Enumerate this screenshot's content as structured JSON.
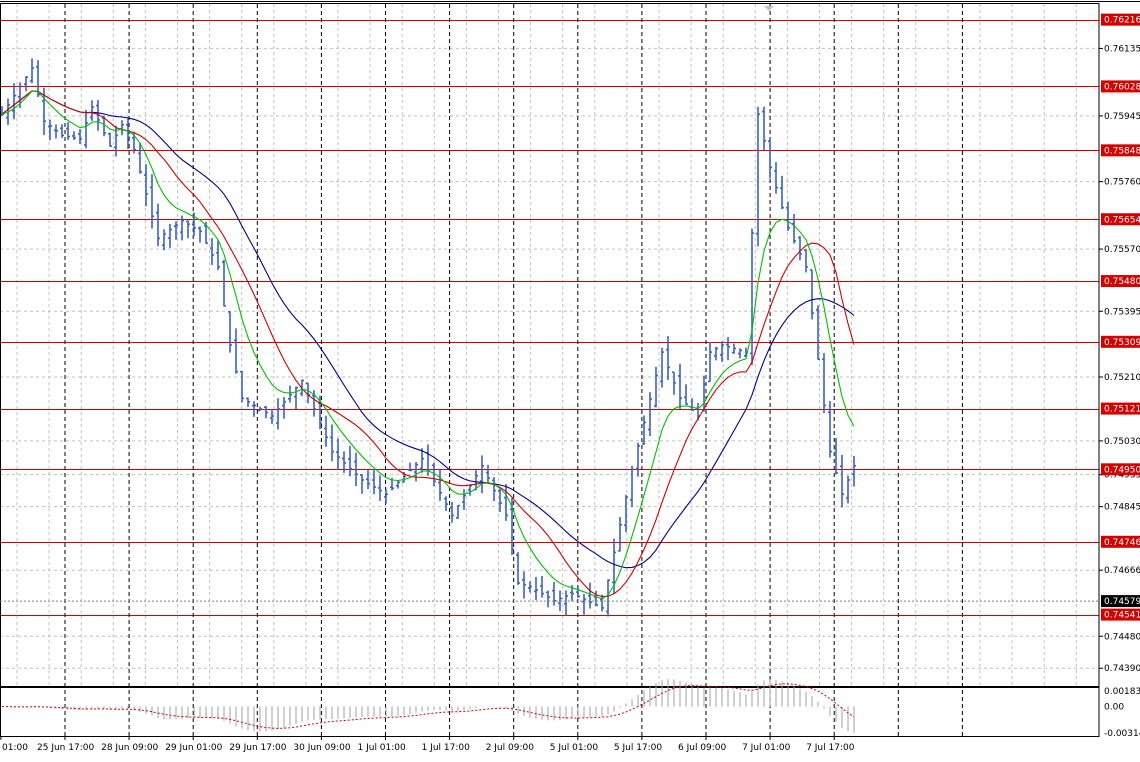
{
  "chart_data": [
    {
      "type": "candlestick",
      "title": "",
      "ylim": [
        0.7434,
        0.7626
      ],
      "grid": true,
      "colors": {
        "background": "#ffffff",
        "bars": "#3a5fcd",
        "grid": "#c0c0c0",
        "vertical_dashed": "#000000",
        "level_lines": "#d40000",
        "level_label_bg": "#d40000",
        "ma_fast": "#00c000",
        "ma_mid": "#d00000",
        "ma_slow": "#000090",
        "current_price_bg": "#000000"
      },
      "price_ticks": [
        "0.76135",
        "0.75945",
        "0.75760",
        "0.75570",
        "0.75395",
        "0.75210",
        "0.75030",
        "0.74935",
        "0.74845",
        "0.74666",
        "0.74480",
        "0.74390"
      ],
      "price_tick_values": [
        0.76135,
        0.75945,
        0.7576,
        0.7557,
        0.75395,
        0.7521,
        0.7503,
        0.74935,
        0.74845,
        0.74666,
        0.7448,
        0.7439
      ],
      "levels": [
        {
          "label": "0.76216",
          "value": 0.76216
        },
        {
          "label": "0.76028",
          "value": 0.76028
        },
        {
          "label": "0.75848",
          "value": 0.75848
        },
        {
          "label": "0.75654",
          "value": 0.75654
        },
        {
          "label": "0.75480",
          "value": 0.7548
        },
        {
          "label": "0.75309",
          "value": 0.75309
        },
        {
          "label": "0.75121",
          "value": 0.75121
        },
        {
          "label": "0.74950",
          "value": 0.7495
        },
        {
          "label": "0.74746",
          "value": 0.74746
        },
        {
          "label": "0.74541",
          "value": 0.74541
        }
      ],
      "current_price": {
        "label": "0.74579",
        "value": 0.74579
      },
      "time_labels": [
        "01:00",
        "25 Jun 17:00",
        "28 Jun 09:00",
        "29 Jun 01:00",
        "29 Jun 17:00",
        "30 Jun 09:00",
        "1 Jul 01:00",
        "1 Jul 17:00",
        "2 Jul 09:00",
        "5 Jul 01:00",
        "5 Jul 17:00",
        "6 Jul 09:00",
        "7 Jul 01:00",
        "7 Jul 17:00"
      ],
      "time_label_positions": [
        0,
        0.5,
        1,
        1.5,
        2,
        2.5,
        3,
        3.5,
        4,
        4.5,
        5,
        5.5,
        6,
        6.5
      ],
      "bar_count": 145,
      "anchors_index": [
        0,
        5,
        7,
        10,
        13,
        15,
        18,
        20,
        22,
        26,
        30,
        33,
        36,
        38,
        40,
        45,
        50,
        55,
        60,
        64,
        70,
        75,
        80,
        84,
        86,
        88,
        92,
        95,
        100,
        105,
        110,
        113,
        116,
        118,
        120,
        124,
        126,
        128,
        131,
        134,
        138,
        140,
        143,
        144
      ],
      "anchors_close": [
        0.7595,
        0.7608,
        0.7593,
        0.7589,
        0.7588,
        0.7597,
        0.7586,
        0.7592,
        0.7585,
        0.756,
        0.7565,
        0.7562,
        0.7552,
        0.753,
        0.7515,
        0.751,
        0.752,
        0.75,
        0.7492,
        0.7488,
        0.7498,
        0.7482,
        0.7496,
        0.7482,
        0.7463,
        0.7462,
        0.7458,
        0.746,
        0.7456,
        0.7495,
        0.7528,
        0.7515,
        0.751,
        0.7528,
        0.753,
        0.7528,
        0.7595,
        0.758,
        0.7563,
        0.7552,
        0.75,
        0.7488,
        0.75,
        0.7495
      ],
      "tail_index": [
        0,
        1,
        2,
        3,
        4,
        5,
        6,
        7,
        8,
        9,
        10,
        11,
        12,
        13,
        14,
        15,
        16,
        17,
        18,
        19,
        20,
        21,
        22,
        23,
        24,
        25,
        26
      ],
      "tail_close": [
        0.7512,
        0.752,
        0.7508,
        0.7515,
        0.7505,
        0.7525,
        0.751,
        0.75,
        0.7475,
        0.7488,
        0.7485,
        0.7487,
        0.748,
        0.7489,
        0.7482,
        0.7486,
        0.748,
        0.7465,
        0.746,
        0.7458,
        0.7456,
        0.7462,
        0.746,
        0.7457,
        0.7458,
        0.7455,
        0.7458
      ],
      "oscillator": {
        "ticks": [
          "0.001838",
          "0.00",
          "-0.00314"
        ],
        "tick_values": [
          0.001838,
          0.0,
          -0.00314
        ],
        "ylim": [
          -0.00314,
          0.001838
        ]
      }
    }
  ]
}
